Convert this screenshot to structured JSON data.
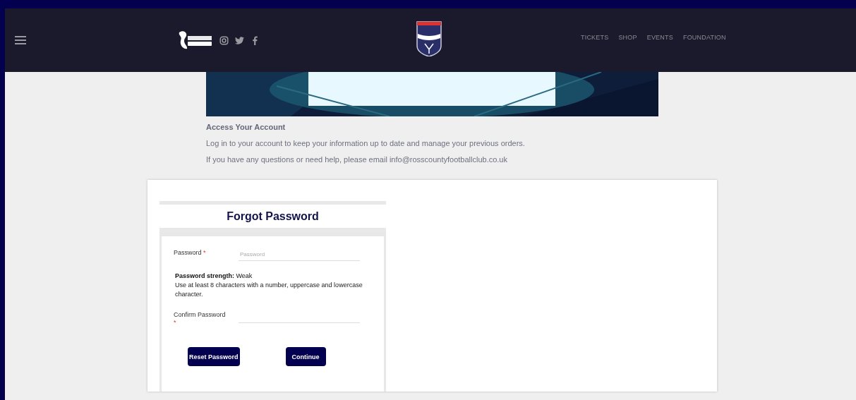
{
  "header": {
    "nav": [
      "TICKETS",
      "SHOP",
      "EVENTS",
      "FOUNDATION"
    ]
  },
  "intro": {
    "heading": "Access Your Account",
    "lines": [
      "Log in to your account to keep your information up to date and manage your previous orders.",
      "If you have any questions or need help, please email info@rosscountyfootballclub.co.uk"
    ]
  },
  "form": {
    "title": "Forgot Password",
    "fields": [
      {
        "label": "Password",
        "required_mark": "*",
        "placeholder": "Password"
      },
      {
        "label": "Confirm Password",
        "required_mark": "*"
      }
    ],
    "strength": "**Password strength:** Weak",
    "hint": "Use at least 8 characters with a number, uppercase and lowercase character.",
    "buttons": [
      "Reset Password",
      "Continue"
    ]
  }
}
